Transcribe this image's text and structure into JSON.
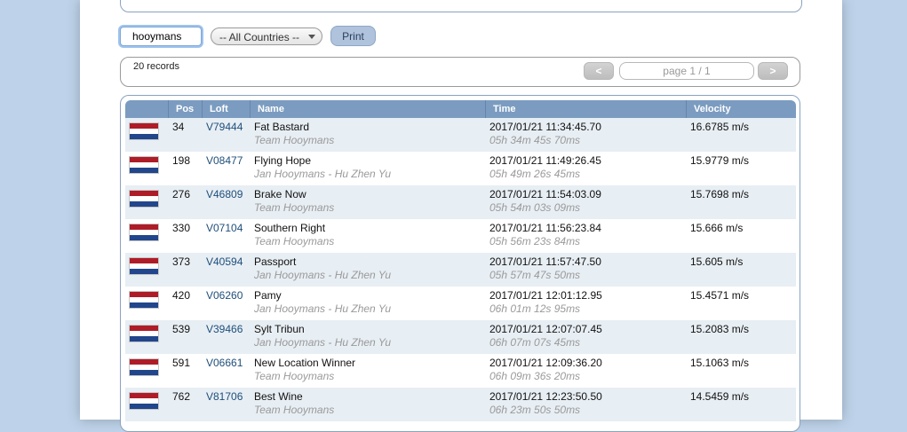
{
  "search": {
    "value": "hooymans"
  },
  "country_filter": {
    "selected": "-- All Countries --"
  },
  "print_label": "Print",
  "records": {
    "count_label": "20 records"
  },
  "pagination": {
    "prev": "<",
    "next": ">",
    "label": "page 1 / 1"
  },
  "table": {
    "columns": [
      "",
      "Pos",
      "Loft",
      "Name",
      "Time",
      "Velocity"
    ],
    "rows": [
      {
        "pos": "34",
        "loft": "V79444",
        "name": "Fat Bastard",
        "team": "Team Hooymans",
        "time": "2017/01/21 11:34:45.70",
        "duration": "05h 34m 45s 70ms",
        "velocity": "16.6785 m/s"
      },
      {
        "pos": "198",
        "loft": "V08477",
        "name": "Flying Hope",
        "team": "Jan Hooymans - Hu Zhen Yu",
        "time": "2017/01/21 11:49:26.45",
        "duration": "05h 49m 26s 45ms",
        "velocity": "15.9779 m/s"
      },
      {
        "pos": "276",
        "loft": "V46809",
        "name": "Brake Now",
        "team": "Team Hooymans",
        "time": "2017/01/21 11:54:03.09",
        "duration": "05h 54m 03s 09ms",
        "velocity": "15.7698 m/s"
      },
      {
        "pos": "330",
        "loft": "V07104",
        "name": "Southern Right",
        "team": "Team Hooymans",
        "time": "2017/01/21 11:56:23.84",
        "duration": "05h 56m 23s 84ms",
        "velocity": "15.666 m/s"
      },
      {
        "pos": "373",
        "loft": "V40594",
        "name": "Passport",
        "team": "Jan Hooymans - Hu Zhen Yu",
        "time": "2017/01/21 11:57:47.50",
        "duration": "05h 57m 47s 50ms",
        "velocity": "15.605 m/s"
      },
      {
        "pos": "420",
        "loft": "V06260",
        "name": "Pamy",
        "team": "Jan Hooymans - Hu Zhen Yu",
        "time": "2017/01/21 12:01:12.95",
        "duration": "06h 01m 12s 95ms",
        "velocity": "15.4571 m/s"
      },
      {
        "pos": "539",
        "loft": "V39466",
        "name": "Sylt Tribun",
        "team": "Jan Hooymans - Hu Zhen Yu",
        "time": "2017/01/21 12:07:07.45",
        "duration": "06h 07m 07s 45ms",
        "velocity": "15.2083 m/s"
      },
      {
        "pos": "591",
        "loft": "V06661",
        "name": "New Location Winner",
        "team": "Team Hooymans",
        "time": "2017/01/21 12:09:36.20",
        "duration": "06h 09m 36s 20ms",
        "velocity": "15.1063 m/s"
      },
      {
        "pos": "762",
        "loft": "V81706",
        "name": "Best Wine",
        "team": "Team Hooymans",
        "time": "2017/01/21 12:23:50.50",
        "duration": "06h 23m 50s 50ms",
        "velocity": "14.5459 m/s"
      }
    ]
  }
}
